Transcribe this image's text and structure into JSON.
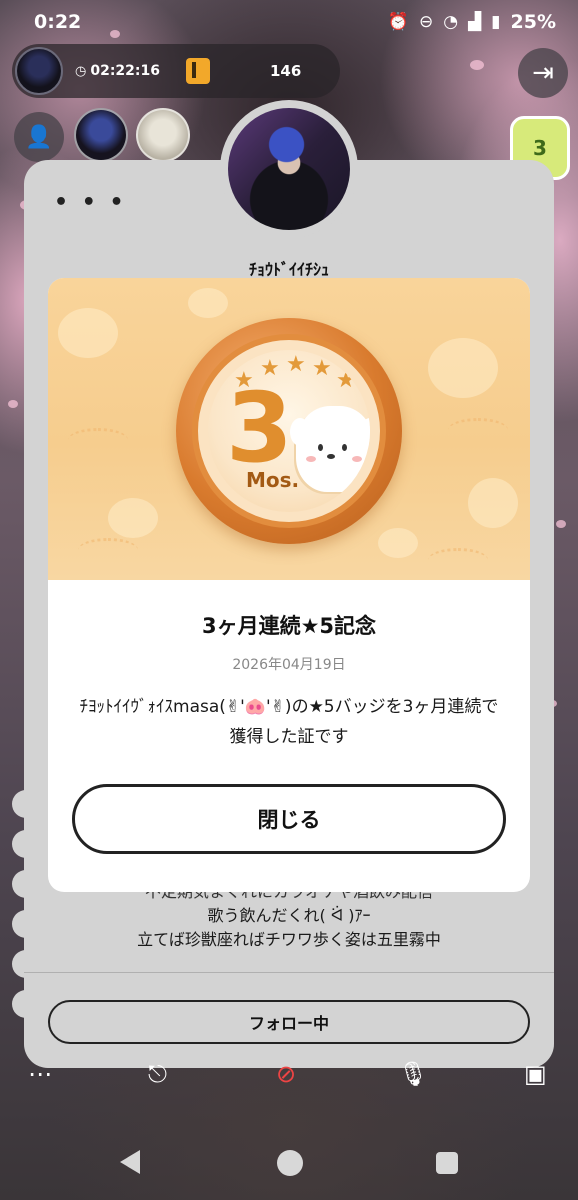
{
  "status_bar": {
    "time": "0:22",
    "battery": "25%",
    "icons": [
      "alarm-icon",
      "dnd-icon",
      "wifi-icon",
      "signal-icon",
      "battery-icon"
    ]
  },
  "stream": {
    "elapsed_time": "02:22:16",
    "viewer_count": "146"
  },
  "profile": {
    "name": "ﾁｮｳﾄﾞｲｲﾁｼｭ",
    "bio_lines": [
      "不定期気まぐれにカラオケや酒飲み配信",
      "歌う飲んだくれ( ᐛ )ｱｰ",
      "立てば珍獣座ればチワワ歩く姿は五里霧中"
    ],
    "follow_label": "フォロー中",
    "menu_label": "• • •"
  },
  "badge": {
    "number": "3",
    "unit": "Mos.",
    "title": "3ヶ月連続★5記念",
    "date": "2026年04月19日",
    "description": "ﾁﾖｯﾄｲｲｳﾞｫｲｽmasa(✌︎'🐽'✌︎)の★5バッジを3ヶ月連続で獲得した証です",
    "close_label": "閉じる",
    "colors": {
      "medal": "#d97b2e",
      "background": "#f9d49a"
    }
  },
  "sticker_text": "3",
  "toolbar_icons": [
    "more-icon",
    "share-icon",
    "mic-off-icon",
    "mic-icon",
    "image-icon"
  ]
}
